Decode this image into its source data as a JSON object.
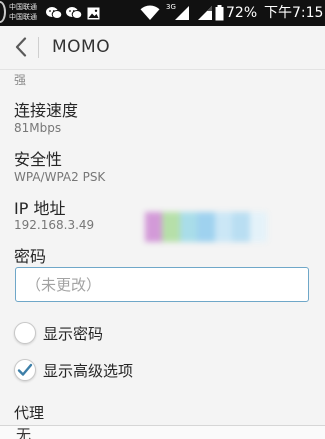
{
  "status_bar": {
    "carrier_1": "中国联通",
    "carrier_2": "中国联通",
    "network_type": "3G",
    "battery": "72%",
    "time": "下午7:15",
    "icons": [
      "dual-sim-icon",
      "wechat-icon",
      "wechat-icon",
      "image-icon",
      "wifi-icon",
      "signal-icon",
      "signal-icon",
      "battery-icon"
    ]
  },
  "action_bar": {
    "back_icon": "chevron-left-icon",
    "title": "MOMO"
  },
  "signal": {
    "value": "强"
  },
  "link_speed": {
    "label": "连接速度",
    "value": "81Mbps"
  },
  "security": {
    "label": "安全性",
    "value": "WPA/WPA2 PSK"
  },
  "ip": {
    "label": "IP 地址",
    "value": "192.168.3.49"
  },
  "password": {
    "label": "密码",
    "placeholder": "（未更改）",
    "value": ""
  },
  "show_password": {
    "label": "显示密码",
    "checked": false
  },
  "show_advanced": {
    "label": "显示高级选项",
    "checked": true
  },
  "proxy": {
    "label": "代理",
    "value": "无"
  },
  "colors": {
    "accent": "#6fa7c8",
    "status_bar": "#111111",
    "background": "#f4f4f4"
  }
}
